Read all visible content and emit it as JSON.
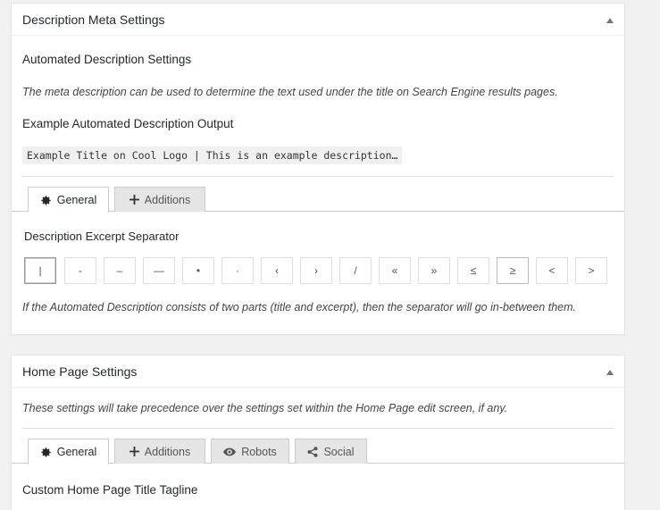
{
  "description_box": {
    "title": "Description Meta Settings",
    "automated_heading": "Automated Description Settings",
    "automated_desc": "The meta description can be used to determine the text used under the title on Search Engine results pages.",
    "example_heading": "Example Automated Description Output",
    "example_output": "Example Title on Cool Logo | This is an example description…",
    "tabs": [
      {
        "label": "General",
        "icon": "gear-icon",
        "active": true
      },
      {
        "label": "Additions",
        "icon": "plus-icon",
        "active": false
      }
    ],
    "separator_heading": "Description Excerpt Separator",
    "separators": [
      "|",
      "-",
      "–",
      "—",
      "•",
      "·",
      "‹",
      "›",
      "/",
      "«",
      "»",
      "≤",
      "≥",
      "<",
      ">"
    ],
    "selected_separator": "|",
    "separator_desc": "If the Automated Description consists of two parts (title and excerpt), then the separator will go in-between them."
  },
  "homepage_box": {
    "title": "Home Page Settings",
    "desc": "These settings will take precedence over the settings set within the Home Page edit screen, if any.",
    "tabs": [
      {
        "label": "General",
        "icon": "gear-icon",
        "active": true
      },
      {
        "label": "Additions",
        "icon": "plus-icon",
        "active": false
      },
      {
        "label": "Robots",
        "icon": "eye-icon",
        "active": false
      },
      {
        "label": "Social",
        "icon": "share-icon",
        "active": false
      }
    ],
    "tagline_heading": "Custom Home Page Title Tagline"
  }
}
